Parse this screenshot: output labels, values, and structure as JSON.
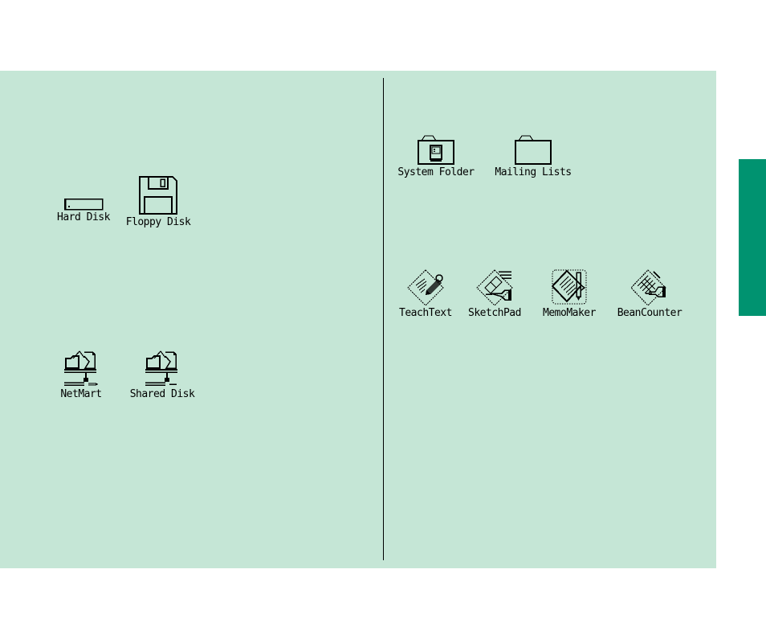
{
  "desktop": {
    "background_color": "#c5e6d6",
    "tab_color": "#009370",
    "left_pane": {
      "disks": [
        {
          "label": "Hard Disk",
          "icon": "hard-disk-icon"
        },
        {
          "label": "Floppy Disk",
          "icon": "floppy-disk-icon"
        }
      ],
      "network": [
        {
          "label": "NetMart",
          "icon": "network-volume-icon"
        },
        {
          "label": "Shared Disk",
          "icon": "network-volume-icon"
        }
      ]
    },
    "right_pane": {
      "folders": [
        {
          "label": "System Folder",
          "icon": "system-folder-icon"
        },
        {
          "label": "Mailing Lists",
          "icon": "folder-icon"
        }
      ],
      "applications": [
        {
          "label": "TeachText",
          "icon": "teachtext-app-icon"
        },
        {
          "label": "SketchPad",
          "icon": "sketchpad-app-icon"
        },
        {
          "label": "MemoMaker",
          "icon": "memomaker-app-icon"
        },
        {
          "label": "BeanCounter",
          "icon": "beancounter-app-icon"
        }
      ]
    }
  }
}
